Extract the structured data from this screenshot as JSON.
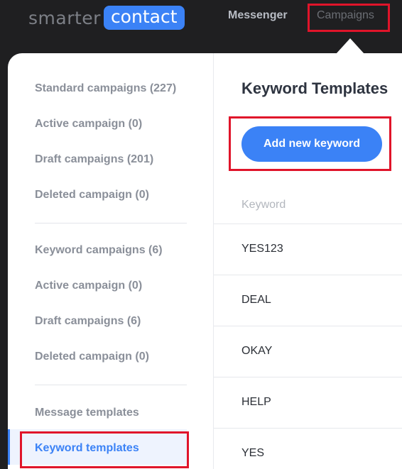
{
  "logo": {
    "left_text": "smarter",
    "right_text": "contact"
  },
  "nav": {
    "messenger": "Messenger",
    "campaigns": "Campaigns"
  },
  "menu": {
    "group1": [
      "Standard campaigns (227)",
      "Active campaign (0)",
      "Draft campaigns (201)",
      "Deleted campaign (0)"
    ],
    "group2": [
      "Keyword campaigns (6)",
      "Active campaign (0)",
      "Draft campaigns (6)",
      "Deleted campaign (0)"
    ],
    "group3": [
      "Message templates",
      "Keyword templates"
    ]
  },
  "content": {
    "title": "Keyword Templates",
    "add_button": "Add new keyword",
    "column_header": "Keyword",
    "rows": [
      "YES123",
      "DEAL",
      "OKAY",
      "HELP",
      "YES"
    ]
  },
  "colors": {
    "accent": "#3b82f6",
    "highlight": "#e0142a"
  }
}
